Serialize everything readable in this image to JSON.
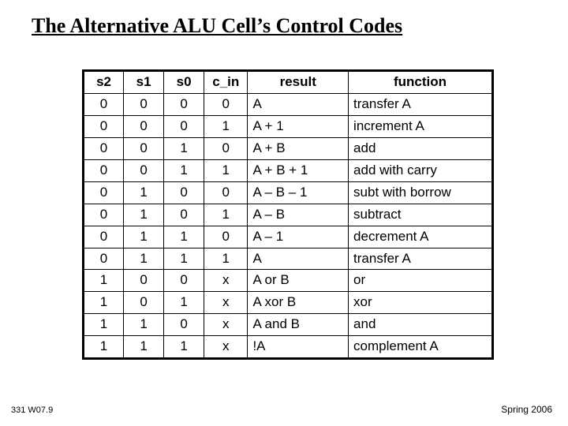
{
  "title": "The Alternative ALU Cell’s Control Codes",
  "headers": {
    "s2": "s2",
    "s1": "s1",
    "s0": "s0",
    "c_in": "c_in",
    "result": "result",
    "function": "function"
  },
  "rows": [
    {
      "s2": "0",
      "s1": "0",
      "s0": "0",
      "c_in": "0",
      "result": "A",
      "function": "transfer A"
    },
    {
      "s2": "0",
      "s1": "0",
      "s0": "0",
      "c_in": "1",
      "result": "A + 1",
      "function": "increment A"
    },
    {
      "s2": "0",
      "s1": "0",
      "s0": "1",
      "c_in": "0",
      "result": "A + B",
      "function": "add"
    },
    {
      "s2": "0",
      "s1": "0",
      "s0": "1",
      "c_in": "1",
      "result": "A + B + 1",
      "function": "add with carry"
    },
    {
      "s2": "0",
      "s1": "1",
      "s0": "0",
      "c_in": "0",
      "result": "A – B – 1",
      "function": "subt with borrow"
    },
    {
      "s2": "0",
      "s1": "1",
      "s0": "0",
      "c_in": "1",
      "result": "A – B",
      "function": "subtract"
    },
    {
      "s2": "0",
      "s1": "1",
      "s0": "1",
      "c_in": "0",
      "result": "A – 1",
      "function": "decrement A"
    },
    {
      "s2": "0",
      "s1": "1",
      "s0": "1",
      "c_in": "1",
      "result": "A",
      "function": "transfer A"
    },
    {
      "s2": "1",
      "s1": "0",
      "s0": "0",
      "c_in": "x",
      "result": "A or B",
      "function": "or"
    },
    {
      "s2": "1",
      "s1": "0",
      "s0": "1",
      "c_in": "x",
      "result": "A xor B",
      "function": "xor"
    },
    {
      "s2": "1",
      "s1": "1",
      "s0": "0",
      "c_in": "x",
      "result": "A and B",
      "function": "and"
    },
    {
      "s2": "1",
      "s1": "1",
      "s0": "1",
      "c_in": "x",
      "result": "!A",
      "function": "complement A"
    }
  ],
  "footer": {
    "left": "331 W07.9",
    "right": "Spring 2006"
  },
  "chart_data": {
    "type": "table",
    "title": "The Alternative ALU Cell’s Control Codes",
    "columns": [
      "s2",
      "s1",
      "s0",
      "c_in",
      "result",
      "function"
    ],
    "rows": [
      [
        "0",
        "0",
        "0",
        "0",
        "A",
        "transfer A"
      ],
      [
        "0",
        "0",
        "0",
        "1",
        "A + 1",
        "increment A"
      ],
      [
        "0",
        "0",
        "1",
        "0",
        "A + B",
        "add"
      ],
      [
        "0",
        "0",
        "1",
        "1",
        "A + B + 1",
        "add with carry"
      ],
      [
        "0",
        "1",
        "0",
        "0",
        "A – B – 1",
        "subt with borrow"
      ],
      [
        "0",
        "1",
        "0",
        "1",
        "A – B",
        "subtract"
      ],
      [
        "0",
        "1",
        "1",
        "0",
        "A – 1",
        "decrement A"
      ],
      [
        "0",
        "1",
        "1",
        "1",
        "A",
        "transfer A"
      ],
      [
        "1",
        "0",
        "0",
        "x",
        "A or B",
        "or"
      ],
      [
        "1",
        "0",
        "1",
        "x",
        "A xor B",
        "xor"
      ],
      [
        "1",
        "1",
        "0",
        "x",
        "A and B",
        "and"
      ],
      [
        "1",
        "1",
        "1",
        "x",
        "!A",
        "complement A"
      ]
    ]
  }
}
